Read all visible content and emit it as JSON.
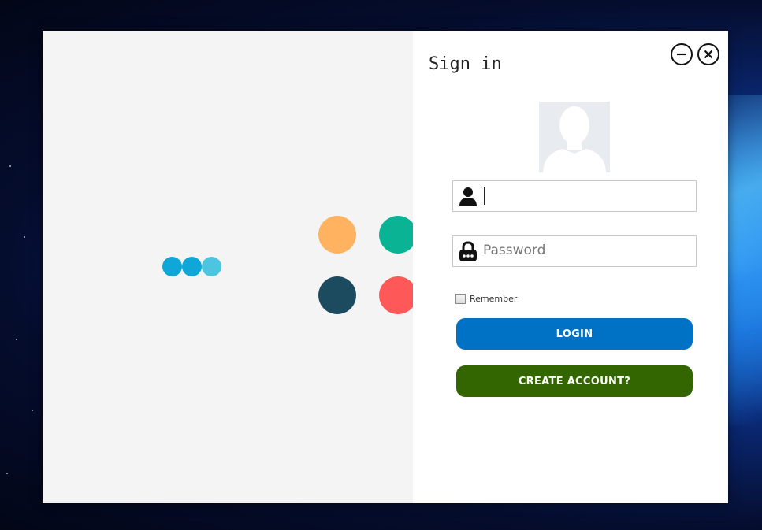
{
  "window": {
    "title": "Sign in",
    "minimize_icon": "minus-circle-icon",
    "close_icon": "x-circle-icon"
  },
  "loader": {
    "colors": [
      "#0ea7d8",
      "#0ea7d8",
      "#4dc4e0"
    ],
    "tiles": [
      "#ffb260",
      "#0ab393",
      "#1c4a5e",
      "#ff5858"
    ]
  },
  "form": {
    "avatar_icon": "user-silhouette-icon",
    "username": {
      "icon": "person-icon",
      "value": "",
      "placeholder": ""
    },
    "password": {
      "icon": "lock-icon",
      "value": "",
      "placeholder": "Password"
    },
    "remember": {
      "label": "Remember",
      "checked": false
    },
    "login_button": {
      "label": "LOGIN",
      "color": "#0072c6"
    },
    "create_button": {
      "label": "CREATE ACCOUNT?",
      "color": "#336600"
    }
  }
}
